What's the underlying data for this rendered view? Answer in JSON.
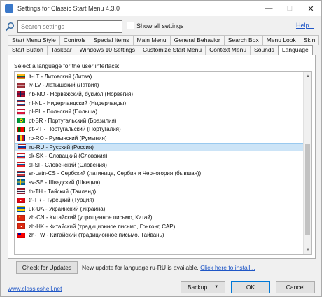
{
  "window": {
    "title": "Settings for Classic Start Menu 4.3.0",
    "minimize_glyph": "—",
    "maximize_glyph": "□",
    "close_glyph": "✕"
  },
  "search": {
    "placeholder": "Search settings",
    "value": ""
  },
  "show_all": {
    "label": "Show all settings",
    "checked": false
  },
  "help_link": "Help...",
  "tabs_row1": [
    "Start Menu Style",
    "Controls",
    "Special Items",
    "Main Menu",
    "General Behavior",
    "Search Box",
    "Menu Look",
    "Skin"
  ],
  "tabs_row2": [
    "Start Button",
    "Taskbar",
    "Windows 10 Settings",
    "Customize Start Menu",
    "Context Menu",
    "Sounds",
    "Language"
  ],
  "active_tab": "Language",
  "panel": {
    "label": "Select a language for the user interface:",
    "languages": [
      {
        "text": "lt-LT - Литовский (Литва)",
        "flag": "lt"
      },
      {
        "text": "lv-LV - Латышский (Латвия)",
        "flag": "lv"
      },
      {
        "text": "nb-NO - Норвежский, букмол (Норвегия)",
        "flag": "no"
      },
      {
        "text": "nl-NL - Нидерландский (Нидерланды)",
        "flag": "nl"
      },
      {
        "text": "pl-PL - Польский (Польша)",
        "flag": "pl"
      },
      {
        "text": "pt-BR - Португальский (Бразилия)",
        "flag": "br"
      },
      {
        "text": "pt-PT - Португальский (Португалия)",
        "flag": "pt"
      },
      {
        "text": "ro-RO - Румынский (Румыния)",
        "flag": "ro"
      },
      {
        "text": "ru-RU - Русский (Россия)",
        "flag": "ru",
        "selected": true
      },
      {
        "text": "sk-SK - Словацкий (Словакия)",
        "flag": "sk"
      },
      {
        "text": "sl-SI - Словенский (Словения)",
        "flag": "si"
      },
      {
        "text": "sr-Latn-CS - Сербский (латиница, Сербия и Черногория (бывшая))",
        "flag": "cs"
      },
      {
        "text": "sv-SE - Шведский (Швеция)",
        "flag": "se"
      },
      {
        "text": "th-TH - Тайский (Таиланд)",
        "flag": "th"
      },
      {
        "text": "tr-TR - Турецкий (Турция)",
        "flag": "tr"
      },
      {
        "text": "uk-UA - Украинский (Украина)",
        "flag": "ua"
      },
      {
        "text": "zh-CN - Китайский (упрощенное письмо, Китай)",
        "flag": "cn"
      },
      {
        "text": "zh-HK - Китайский (традиционное письмо, Гонконг, САР)",
        "flag": "hk"
      },
      {
        "text": "zh-TW - Китайский (традиционное письмо, Тайвань)",
        "flag": "tw"
      }
    ],
    "scroll_position": 0.85
  },
  "update": {
    "button_label": "Check for Updates",
    "message": "New update for language ru-RU is available.",
    "link": "Click here to install..."
  },
  "footer": {
    "site_link": "www.classicshell.net",
    "backup_label": "Backup",
    "backup_arrow": "▼",
    "ok_label": "OK",
    "cancel_label": "Cancel"
  },
  "colors": {
    "link": "#1f56c6",
    "selection_bg": "#cce4f7",
    "selection_border": "#99c9ef",
    "default_button_border": "#0078d7"
  }
}
